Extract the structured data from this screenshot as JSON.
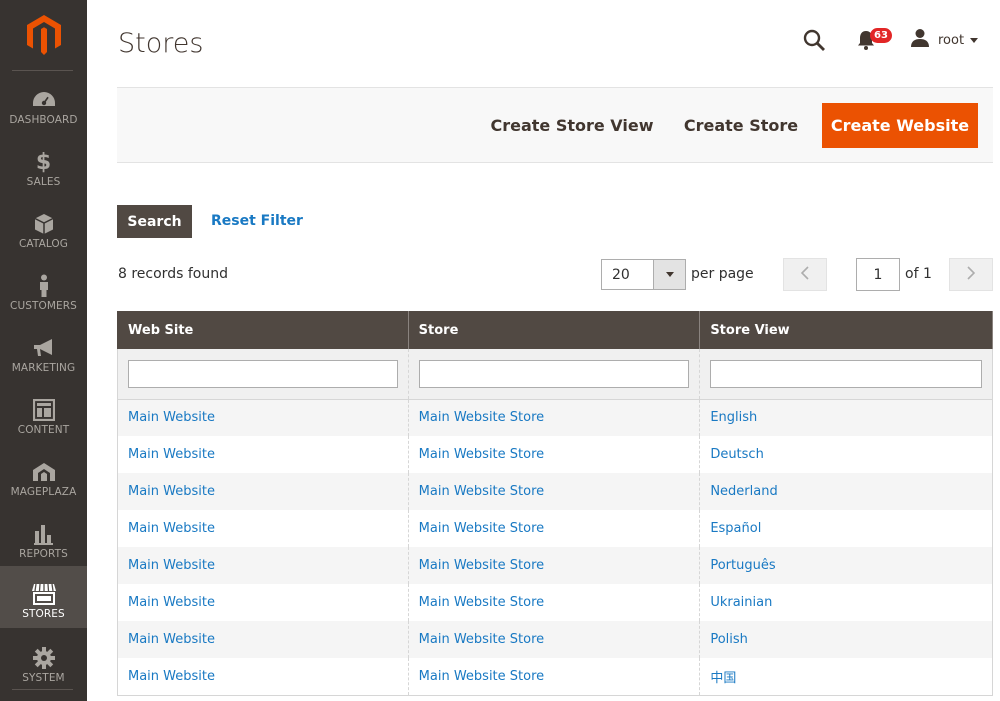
{
  "colors": {
    "sidebar_bg": "#373330",
    "sidebar_active": "#524d49",
    "brand_accent": "#eb5202",
    "link": "#1979c3",
    "header_bg": "#514943",
    "badge": "#e22626"
  },
  "sidebar": {
    "logo_icon": "magento-logo-icon",
    "items": [
      {
        "label": "DASHBOARD",
        "icon": "dashboard-icon"
      },
      {
        "label": "SALES",
        "icon": "dollar-icon"
      },
      {
        "label": "CATALOG",
        "icon": "cube-icon"
      },
      {
        "label": "CUSTOMERS",
        "icon": "person-icon"
      },
      {
        "label": "MARKETING",
        "icon": "megaphone-icon"
      },
      {
        "label": "CONTENT",
        "icon": "layout-icon"
      },
      {
        "label": "MAGEPLAZA",
        "icon": "mageplaza-icon"
      },
      {
        "label": "REPORTS",
        "icon": "bar-chart-icon"
      },
      {
        "label": "STORES",
        "icon": "storefront-icon",
        "active": true
      },
      {
        "label": "SYSTEM",
        "icon": "gear-icon"
      }
    ]
  },
  "header": {
    "title": "Stores",
    "notifications_count": "63",
    "user_name": "root"
  },
  "actions": {
    "create_store_view": "Create Store View",
    "create_store": "Create Store",
    "create_website": "Create Website"
  },
  "search": {
    "search_label": "Search",
    "reset_label": "Reset Filter"
  },
  "pager": {
    "records_found": "8 records found",
    "per_page_value": "20",
    "per_page_label": "per page",
    "current_page": "1",
    "of_pages": "of 1"
  },
  "grid": {
    "columns": [
      "Web Site",
      "Store",
      "Store View"
    ],
    "rows": [
      [
        "Main Website",
        "Main Website Store",
        "English"
      ],
      [
        "Main Website",
        "Main Website Store",
        "Deutsch"
      ],
      [
        "Main Website",
        "Main Website Store",
        "Nederland"
      ],
      [
        "Main Website",
        "Main Website Store",
        "Español"
      ],
      [
        "Main Website",
        "Main Website Store",
        "Português"
      ],
      [
        "Main Website",
        "Main Website Store",
        "Ukrainian"
      ],
      [
        "Main Website",
        "Main Website Store",
        "Polish"
      ],
      [
        "Main Website",
        "Main Website Store",
        "中国"
      ]
    ]
  }
}
